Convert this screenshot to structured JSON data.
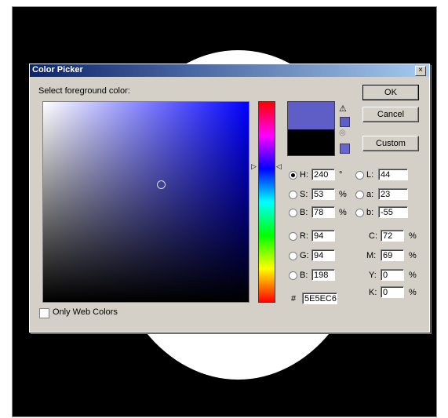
{
  "dialog": {
    "title": "Color Picker",
    "close_glyph": "×",
    "select_label": "Select foreground color:",
    "buttons": {
      "ok": "OK",
      "cancel": "Cancel",
      "custom": "Custom"
    },
    "hsb": {
      "h": {
        "label": "H:",
        "value": "240",
        "unit": "°",
        "selected": true
      },
      "s": {
        "label": "S:",
        "value": "53",
        "unit": "%"
      },
      "b": {
        "label": "B:",
        "value": "78",
        "unit": "%"
      }
    },
    "lab": {
      "l": {
        "label": "L:",
        "value": "44"
      },
      "a": {
        "label": "a:",
        "value": "23"
      },
      "b": {
        "label": "b:",
        "value": "-55"
      }
    },
    "rgb": {
      "r": {
        "label": "R:",
        "value": "94"
      },
      "g": {
        "label": "G:",
        "value": "94"
      },
      "b": {
        "label": "B:",
        "value": "198"
      }
    },
    "cmyk": {
      "c": {
        "label": "C:",
        "value": "72",
        "unit": "%"
      },
      "m": {
        "label": "M:",
        "value": "69",
        "unit": "%"
      },
      "y": {
        "label": "Y:",
        "value": "0",
        "unit": "%"
      },
      "k": {
        "label": "K:",
        "value": "0",
        "unit": "%"
      }
    },
    "hex": {
      "label": "#",
      "value": "5E5EC6"
    },
    "only_web_colors_label": "Only Web Colors",
    "colors": {
      "new": "#5e5ec6",
      "old": "#000000"
    }
  }
}
